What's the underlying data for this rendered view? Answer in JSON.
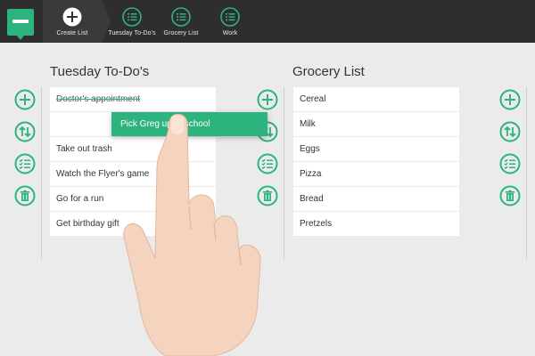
{
  "nav": {
    "items": [
      {
        "label": "Create List",
        "icon": "plus-icon"
      },
      {
        "label": "Tuesday To-Do's",
        "icon": "checklist-icon"
      },
      {
        "label": "Grocery List",
        "icon": "checklist-icon"
      },
      {
        "label": "Work",
        "icon": "checklist-icon"
      }
    ]
  },
  "left_list": {
    "title": "Tuesday To-Do's",
    "items": [
      {
        "text": "Doctor's appointment",
        "done": true
      },
      {
        "text": ""
      },
      {
        "text": "Take out trash"
      },
      {
        "text": "Watch the Flyer's game"
      },
      {
        "text": "Go for a run"
      },
      {
        "text": "Get birthday gift"
      }
    ],
    "dragging": "Pick Greg up at school"
  },
  "right_list": {
    "title": "Grocery List",
    "items": [
      "Cereal",
      "Milk",
      "Eggs",
      "Pizza",
      "Bread",
      "Pretzels"
    ]
  },
  "actions": [
    "add-icon",
    "sort-icon",
    "checklist-icon",
    "trash-icon"
  ],
  "colors": {
    "accent": "#2db37e",
    "topbar": "#2e2e2e",
    "background": "#ebebeb"
  }
}
